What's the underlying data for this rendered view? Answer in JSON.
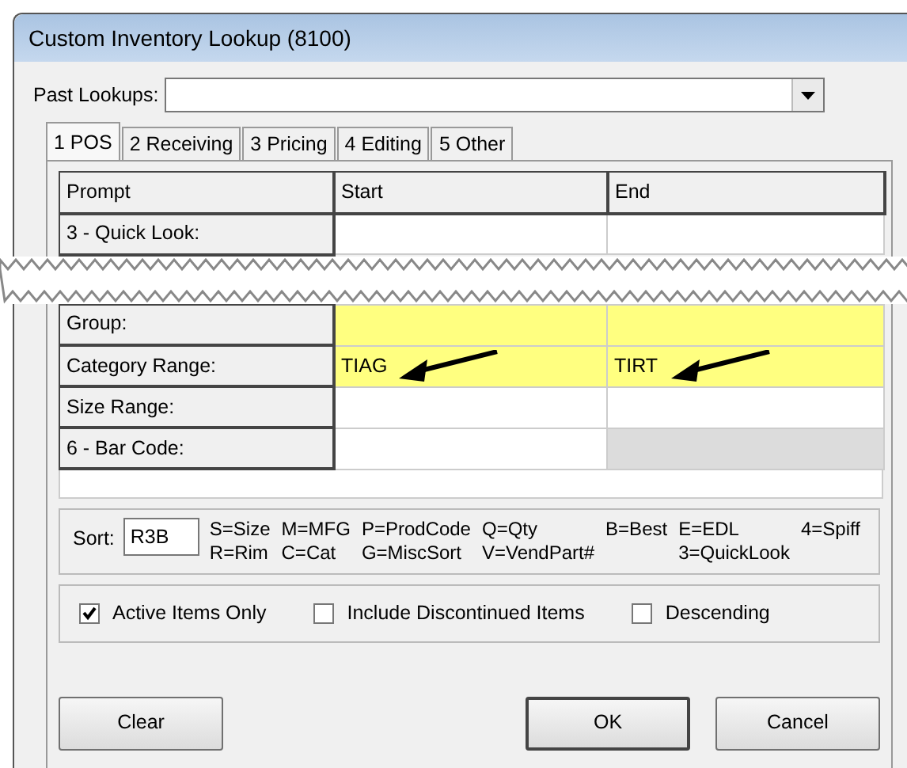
{
  "window": {
    "title": "Custom Inventory Lookup (8100)"
  },
  "past_lookups": {
    "label": "Past Lookups:"
  },
  "tabs": [
    {
      "label": "1 POS",
      "selected": true
    },
    {
      "label": "2 Receiving",
      "selected": false
    },
    {
      "label": "3 Pricing",
      "selected": false
    },
    {
      "label": "4 Editing",
      "selected": false
    },
    {
      "label": "5 Other",
      "selected": false
    }
  ],
  "table": {
    "columns": [
      "Prompt",
      "Start",
      "End"
    ],
    "rows_before_break": [
      {
        "prompt": "3 - Quick Look:",
        "highlighted": false,
        "end_disabled": false
      }
    ],
    "rows": [
      {
        "prompt": "Group:",
        "highlighted": true,
        "end_disabled": false,
        "arrows": false
      },
      {
        "prompt": "Category Range:",
        "start": "TIAG",
        "end": "TIRT",
        "highlighted": true,
        "end_disabled": false,
        "arrows": true
      },
      {
        "prompt": "Size Range:",
        "highlighted": false,
        "end_disabled": false,
        "arrows": false
      },
      {
        "prompt": "6 - Bar Code:",
        "highlighted": false,
        "end_disabled": true,
        "arrows": false
      }
    ]
  },
  "sort": {
    "label": "Sort:",
    "value": "R3B",
    "legend_columns": [
      [
        "S=Size",
        "R=Rim"
      ],
      [
        "M=MFG",
        "C=Cat"
      ],
      [
        "P=ProdCode",
        "G=MiscSort"
      ],
      [
        "Q=Qty",
        "V=VendPart#"
      ],
      [
        "B=Best"
      ],
      [
        "E=EDL",
        "3=QuickLook"
      ],
      [
        "4=Spiff"
      ]
    ]
  },
  "options": [
    {
      "label": "Active Items Only",
      "checked": true
    },
    {
      "label": "Include Discontinued Items",
      "checked": false
    },
    {
      "label": "Descending",
      "checked": false
    }
  ],
  "buttons": [
    {
      "label": "Clear",
      "kind": "left"
    },
    {
      "label": "OK",
      "kind": "default"
    },
    {
      "label": "Cancel",
      "kind": "right"
    }
  ]
}
